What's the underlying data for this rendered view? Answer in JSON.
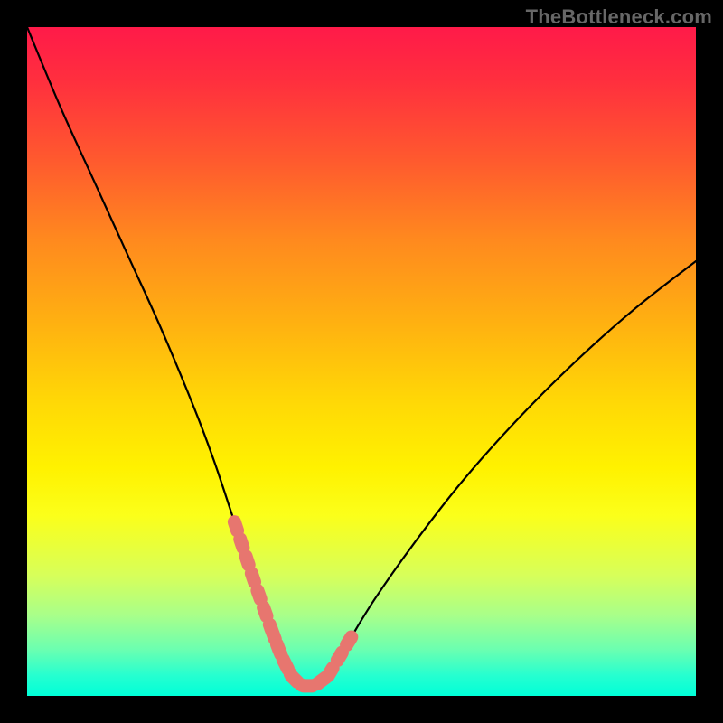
{
  "watermark": "TheBottleneck.com",
  "colors": {
    "background": "#000000",
    "curve": "#000000",
    "highlight": "#e7766f",
    "gradient_top": "#ff1a49",
    "gradient_bottom": "#00ffd8"
  },
  "chart_data": {
    "type": "line",
    "title": "",
    "xlabel": "",
    "ylabel": "",
    "xlim": [
      0,
      100
    ],
    "ylim": [
      0,
      100
    ],
    "series": [
      {
        "name": "bottleneck-curve",
        "x": [
          0,
          5,
          10,
          15,
          20,
          25,
          28,
          31,
          34,
          36.5,
          38,
          39.5,
          41,
          43,
          45,
          48,
          52,
          58,
          65,
          73,
          82,
          91,
          100
        ],
        "y": [
          100,
          88,
          77,
          66,
          55,
          43,
          35,
          26,
          17,
          10,
          6,
          3,
          1.5,
          1.5,
          3,
          8,
          14.5,
          23,
          32,
          41,
          50,
          58,
          65
        ]
      }
    ],
    "highlight_segments": [
      {
        "x_start": 31,
        "x_end": 36.5
      },
      {
        "x_start": 36.5,
        "x_end": 45
      },
      {
        "x_start": 45,
        "x_end": 49
      }
    ]
  }
}
